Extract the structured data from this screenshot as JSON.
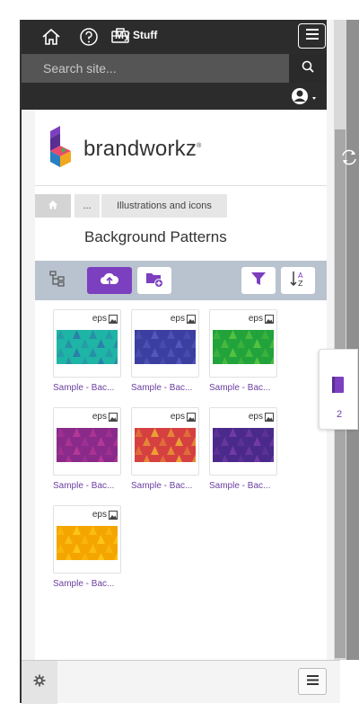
{
  "header": {
    "mystuff_label": "My Stuff",
    "icons": [
      "home-icon",
      "help-icon",
      "briefcase-icon",
      "hamburger-menu-icon"
    ]
  },
  "search": {
    "placeholder": "Search site..."
  },
  "brand": {
    "name": "brandworkz",
    "trademark": "®"
  },
  "breadcrumb": {
    "home_icon": "home-icon",
    "ellipsis": "...",
    "current": "Illustrations and icons"
  },
  "page": {
    "title": "Background Patterns"
  },
  "toolbar": {
    "icons": [
      "tree-view-icon",
      "upload-cloud-icon",
      "new-folder-icon",
      "filter-icon",
      "sort-az-icon"
    ],
    "accent": "#7b3fbf"
  },
  "assets": [
    {
      "label": "Sample - Bac...",
      "format": "eps",
      "colors": [
        "#1fb5a6",
        "#2f6fa8"
      ]
    },
    {
      "label": "Sample - Bac...",
      "format": "eps",
      "colors": [
        "#3b3fa0",
        "#5f5fc8"
      ]
    },
    {
      "label": "Sample - Bac...",
      "format": "eps",
      "colors": [
        "#22a33b",
        "#66cc44"
      ]
    },
    {
      "label": "Sample - Bac...",
      "format": "eps",
      "colors": [
        "#8a2a8a",
        "#c23d9a"
      ]
    },
    {
      "label": "Sample - Bac...",
      "format": "eps",
      "colors": [
        "#d64040",
        "#f0c030"
      ]
    },
    {
      "label": "Sample - Bac...",
      "format": "eps",
      "colors": [
        "#4a2a8a",
        "#8040b0"
      ]
    },
    {
      "label": "Sample - Bac...",
      "format": "eps",
      "colors": [
        "#f5a500",
        "#ffd21f"
      ]
    }
  ],
  "side_panel": {
    "count": "2",
    "icon": "book-icon"
  },
  "footer": {
    "icons": [
      "gear-icon",
      "hamburger-menu-icon"
    ]
  },
  "colors": {
    "link": "#6b3fa0",
    "header_bg": "#2c2c2c",
    "toolbar_bg": "#b9c3cf"
  }
}
